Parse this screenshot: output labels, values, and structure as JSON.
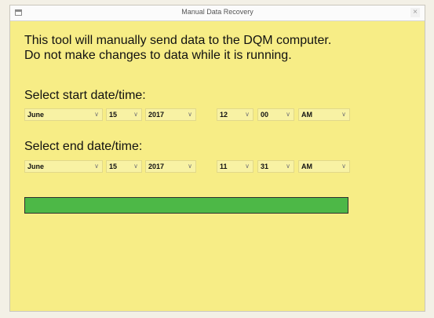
{
  "window": {
    "title": "Manual Data Recovery",
    "close_glyph": "×",
    "background_color": "#f7ed86"
  },
  "instructions": {
    "line1": "This tool will manually send data to the DQM computer.",
    "line2": "Do not make changes to data while it is running."
  },
  "start": {
    "label": "Select start date/time:",
    "month": "June",
    "day": "15",
    "year": "2017",
    "hour": "12",
    "minute": "00",
    "ampm": "AM"
  },
  "end": {
    "label": "Select end date/time:",
    "month": "June",
    "day": "15",
    "year": "2017",
    "hour": "11",
    "minute": "31",
    "ampm": "AM"
  },
  "progress": {
    "fraction": 1.0,
    "fill_color": "#4db847"
  },
  "icons": {
    "app": "window-icon",
    "close": "close-icon",
    "dropdown": "chevron-down-icon"
  }
}
